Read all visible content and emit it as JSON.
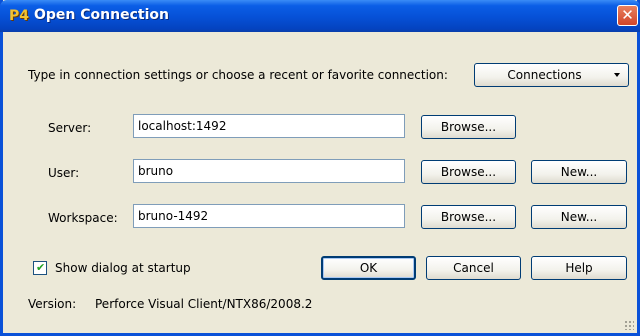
{
  "window": {
    "title": "Open Connection",
    "app_icon_glyph": "P4",
    "close_glyph": "✕"
  },
  "intro": {
    "text": "Type in connection settings or choose a recent or favorite connection:",
    "connections_label": "Connections"
  },
  "fields": {
    "server": {
      "label": "Server:",
      "value": "localhost:1492",
      "browse": "Browse..."
    },
    "user": {
      "label": "User:",
      "value": "bruno",
      "browse": "Browse...",
      "new": "New..."
    },
    "workspace": {
      "label": "Workspace:",
      "value": "bruno-1492",
      "browse": "Browse...",
      "new": "New..."
    }
  },
  "startup": {
    "label": "Show dialog at startup",
    "checked": true,
    "check_glyph": "✔"
  },
  "buttons": {
    "ok": "OK",
    "cancel": "Cancel",
    "help": "Help"
  },
  "version": {
    "label": "Version:",
    "value": "Perforce Visual Client/NTX86/2008.2"
  }
}
